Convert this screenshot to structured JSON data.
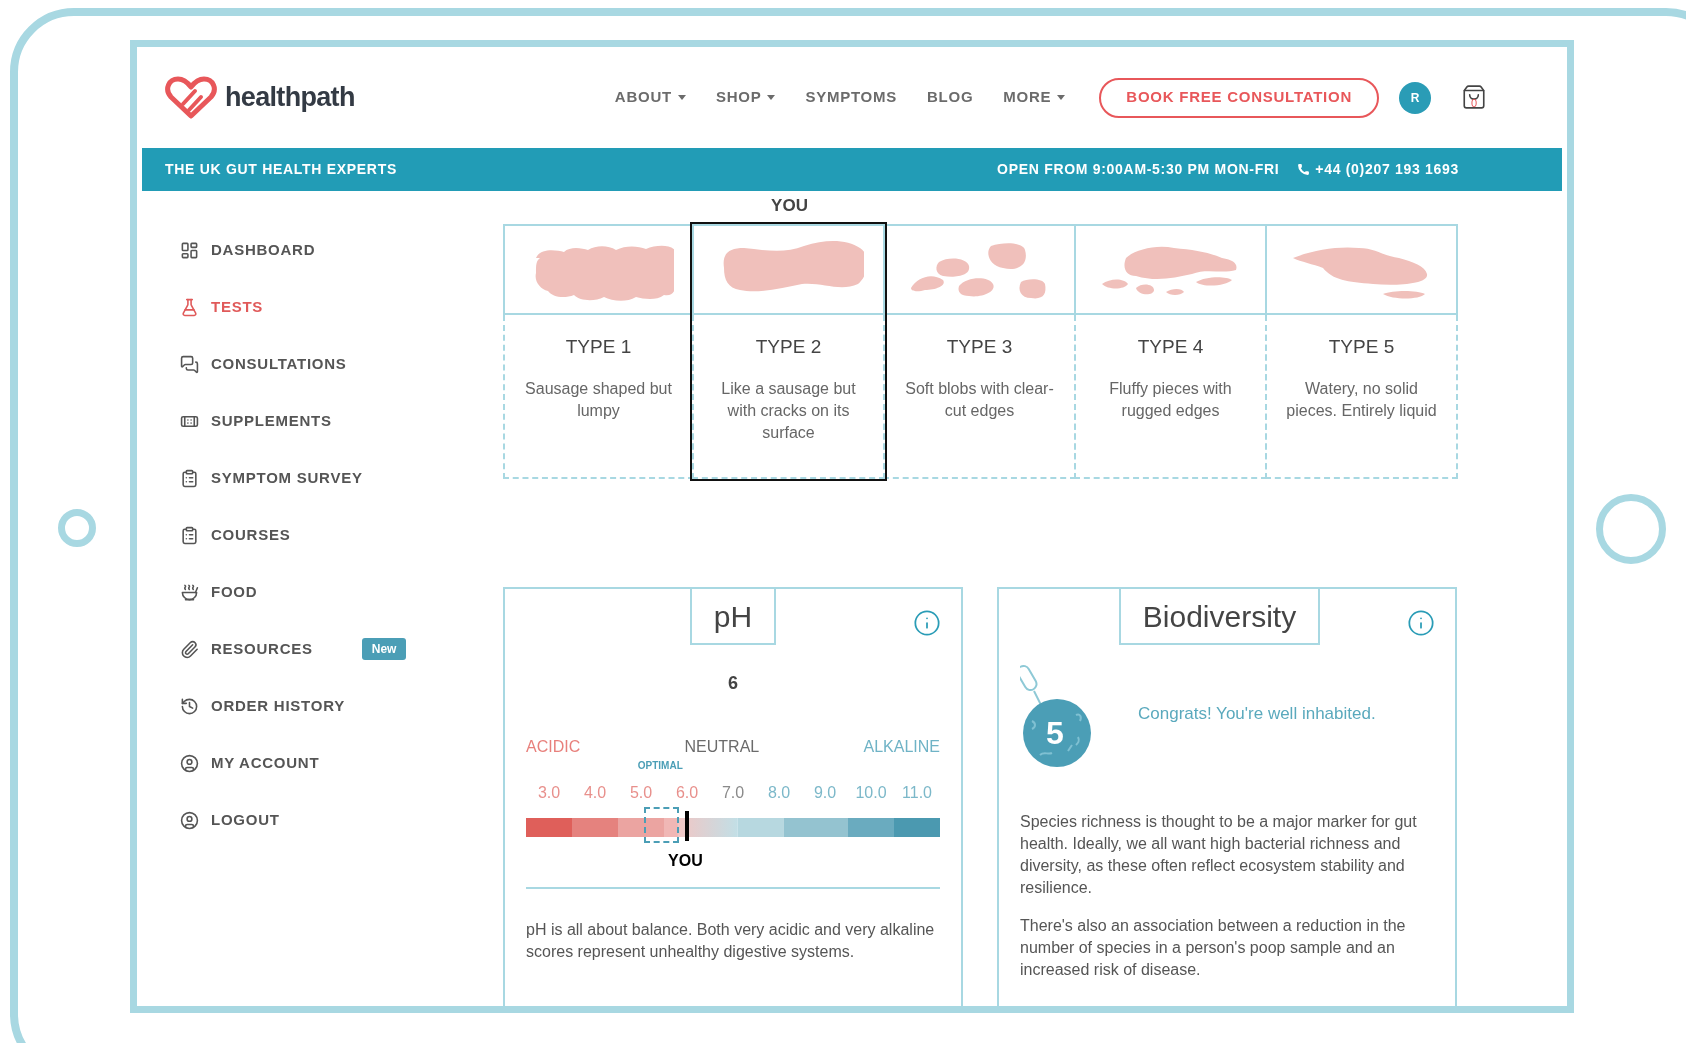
{
  "header": {
    "logo_text": "healthpath",
    "nav": [
      {
        "label": "ABOUT",
        "dropdown": true
      },
      {
        "label": "SHOP",
        "dropdown": true
      },
      {
        "label": "SYMPTOMS",
        "dropdown": false
      },
      {
        "label": "BLOG",
        "dropdown": false
      },
      {
        "label": "MORE",
        "dropdown": true
      }
    ],
    "cta": "BOOK FREE CONSULTATION",
    "avatar": "R",
    "cart_count": "0"
  },
  "banner": {
    "tagline": "THE UK GUT HEALTH EXPERTS",
    "hours": "OPEN FROM 9:00AM-5:30 PM MON-FRI",
    "phone": "+44 (0)207 193 1693"
  },
  "sidebar": {
    "items": [
      {
        "label": "DASHBOARD",
        "selected": false
      },
      {
        "label": "TESTS",
        "selected": true
      },
      {
        "label": "CONSULTATIONS",
        "selected": false
      },
      {
        "label": "SUPPLEMENTS",
        "selected": false
      },
      {
        "label": "SYMPTOM SURVEY",
        "selected": false
      },
      {
        "label": "COURSES",
        "selected": false
      },
      {
        "label": "FOOD",
        "selected": false
      },
      {
        "label": "RESOURCES",
        "selected": false,
        "badge": "New"
      },
      {
        "label": "ORDER HISTORY",
        "selected": false
      },
      {
        "label": "MY ACCOUNT",
        "selected": false
      },
      {
        "label": "LOGOUT",
        "selected": false
      }
    ]
  },
  "stool_types": {
    "you_label": "YOU",
    "types": [
      {
        "title": "TYPE 1",
        "description": "Sausage shaped but lumpy",
        "selected": false
      },
      {
        "title": "TYPE 2",
        "description": "Like a sausage but with cracks on its surface",
        "selected": true
      },
      {
        "title": "TYPE 3",
        "description": "Soft blobs with clear-cut edges",
        "selected": false
      },
      {
        "title": "TYPE 4",
        "description": "Fluffy pieces with rugged edges",
        "selected": false
      },
      {
        "title": "TYPE 5",
        "description": "Watery, no solid pieces. Entirely liquid",
        "selected": false
      }
    ]
  },
  "ph_panel": {
    "title": "pH",
    "value": "6",
    "zones": [
      {
        "label": "ACIDIC",
        "kind": "acidic"
      },
      {
        "label": "NEUTRAL",
        "kind": "neutral"
      },
      {
        "label": "ALKALINE",
        "kind": "alkaline"
      }
    ],
    "optimal_label": "OPTIMAL",
    "ticks": [
      {
        "label": "3.0",
        "kind": "acidic"
      },
      {
        "label": "4.0",
        "kind": "acidic"
      },
      {
        "label": "5.0",
        "kind": "acidic"
      },
      {
        "label": "6.0",
        "kind": "acidic"
      },
      {
        "label": "7.0",
        "kind": "neutral"
      },
      {
        "label": "8.0",
        "kind": "alkaline"
      },
      {
        "label": "9.0",
        "kind": "alkaline"
      },
      {
        "label": "10.0",
        "kind": "alkaline"
      },
      {
        "label": "11.0",
        "kind": "alkaline"
      }
    ],
    "marker": {
      "label": "YOU",
      "level": 0.385
    },
    "description": "pH is all about balance. Both very acidic and very alkaline scores represent unhealthy digestive systems."
  },
  "biodiversity_panel": {
    "title": "Biodiversity",
    "score": "5",
    "message": "Congrats! You're well inhabited.",
    "paragraphs": [
      "Species richness is thought to be a major marker for gut health. Ideally, we all want high bacterial richness and diversity, as these often reflect ecosystem stability and resilience.",
      "There's also an association between a reduction in the number of species in a person's poop sample and an increased risk of disease."
    ]
  }
}
